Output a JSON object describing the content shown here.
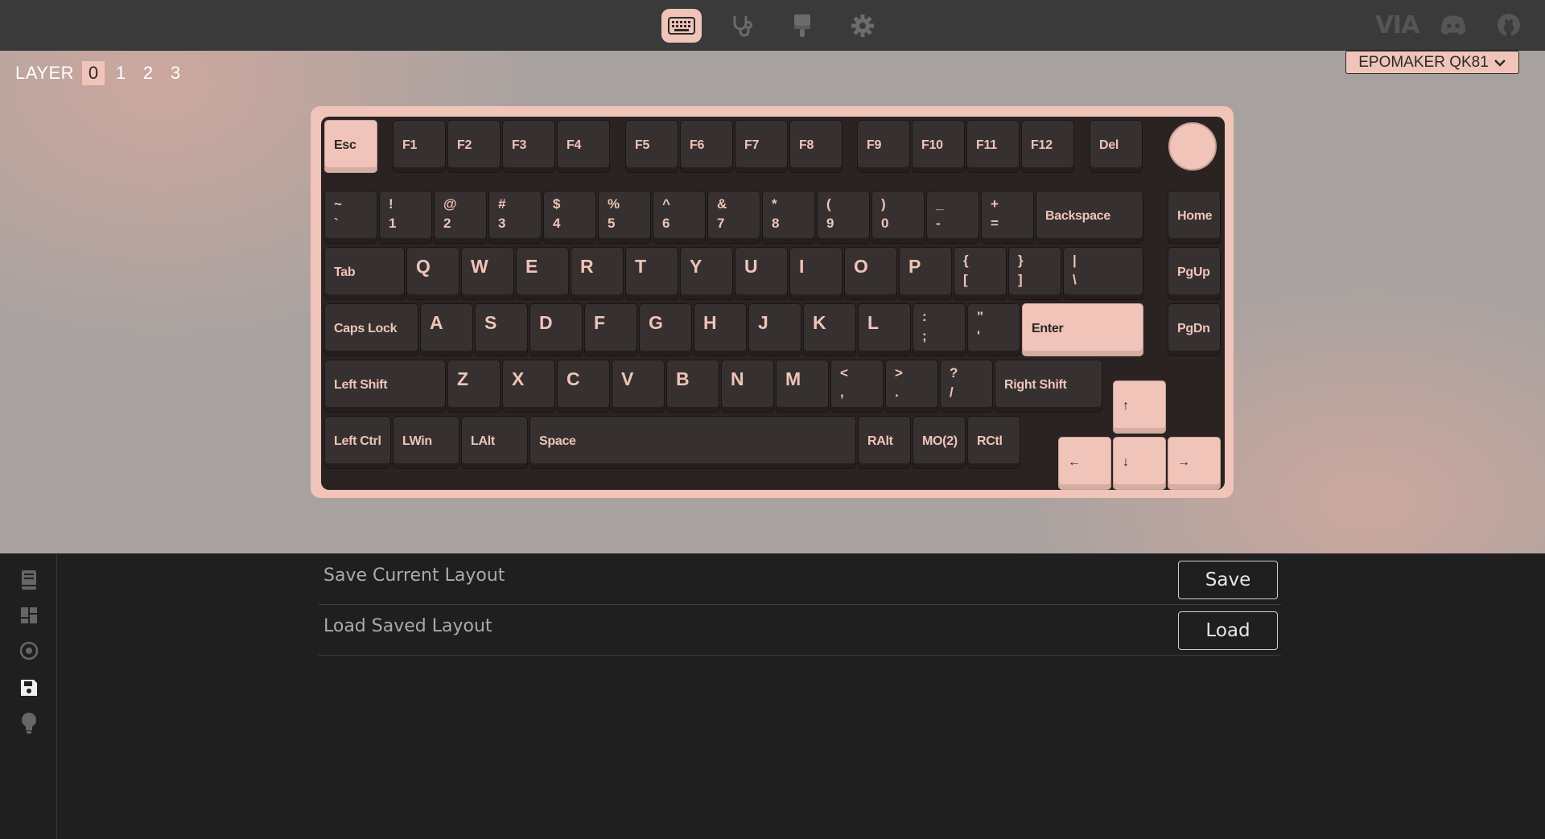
{
  "header": {
    "nav": [
      {
        "icon": "keyboard-icon",
        "active": true
      },
      {
        "icon": "stethoscope-icon",
        "active": false
      },
      {
        "icon": "paintbrush-icon",
        "active": false
      },
      {
        "icon": "gear-icon",
        "active": false
      }
    ],
    "brand": "VIA",
    "links": [
      "discord-icon",
      "github-icon"
    ]
  },
  "layers": {
    "label": "LAYER",
    "items": [
      "0",
      "1",
      "2",
      "3"
    ],
    "selected": "0"
  },
  "device": {
    "name": "EPOMAKER QK81"
  },
  "keyboard": {
    "accent_color": "#f0c4b8",
    "keycap_color": "#363130",
    "keys": {
      "esc": "Esc",
      "f1": "F1",
      "f2": "F2",
      "f3": "F3",
      "f4": "F4",
      "f5": "F5",
      "f6": "F6",
      "f7": "F7",
      "f8": "F8",
      "f9": "F9",
      "f10": "F10",
      "f11": "F11",
      "f12": "F12",
      "del": "Del",
      "grave_top": "~",
      "grave_bot": "`",
      "n1_top": "!",
      "n1_bot": "1",
      "n2_top": "@",
      "n2_bot": "2",
      "n3_top": "#",
      "n3_bot": "3",
      "n4_top": "$",
      "n4_bot": "4",
      "n5_top": "%",
      "n5_bot": "5",
      "n6_top": "^",
      "n6_bot": "6",
      "n7_top": "&",
      "n7_bot": "7",
      "n8_top": "*",
      "n8_bot": "8",
      "n9_top": "(",
      "n9_bot": "9",
      "n0_top": ")",
      "n0_bot": "0",
      "minus_top": "_",
      "minus_bot": "-",
      "equal_top": "+",
      "equal_bot": "=",
      "backspace": "Backspace",
      "home": "Home",
      "tab": "Tab",
      "q": "Q",
      "w": "W",
      "e": "E",
      "r": "R",
      "t": "T",
      "y": "Y",
      "u": "U",
      "i": "I",
      "o": "O",
      "p": "P",
      "lbr_top": "{",
      "lbr_bot": "[",
      "rbr_top": "}",
      "rbr_bot": "]",
      "bsl_top": "|",
      "bsl_bot": "\\",
      "pgup": "PgUp",
      "caps": "Caps Lock",
      "a": "A",
      "s": "S",
      "d": "D",
      "f": "F",
      "g": "G",
      "h": "H",
      "j": "J",
      "k": "K",
      "l": "L",
      "semi_top": ":",
      "semi_bot": ";",
      "quote_top": "\"",
      "quote_bot": "'",
      "enter": "Enter",
      "pgdn": "PgDn",
      "lshift": "Left Shift",
      "z": "Z",
      "x": "X",
      "c": "C",
      "v": "V",
      "b": "B",
      "n": "N",
      "m": "M",
      "comma_top": "<",
      "comma_bot": ",",
      "dot_top": ">",
      "dot_bot": ".",
      "slash_top": "?",
      "slash_bot": "/",
      "rshift": "Right Shift",
      "up": "↑",
      "lctrl": "Left Ctrl",
      "lwin": "LWin",
      "lalt": "LAlt",
      "space": "Space",
      "ralt": "RAlt",
      "mo2": "MO(2)",
      "rctl": "RCtl",
      "left": "←",
      "down": "↓",
      "right": "→"
    }
  },
  "sidebar": {
    "items": [
      {
        "icon": "book-icon",
        "active": false
      },
      {
        "icon": "dashboard-icon",
        "active": false
      },
      {
        "icon": "target-icon",
        "active": false
      },
      {
        "icon": "save-icon",
        "active": true
      },
      {
        "icon": "lightbulb-icon",
        "active": false
      }
    ]
  },
  "save_load": {
    "save_label": "Save Current Layout",
    "save_button": "Save",
    "load_label": "Load Saved Layout",
    "load_button": "Load"
  }
}
